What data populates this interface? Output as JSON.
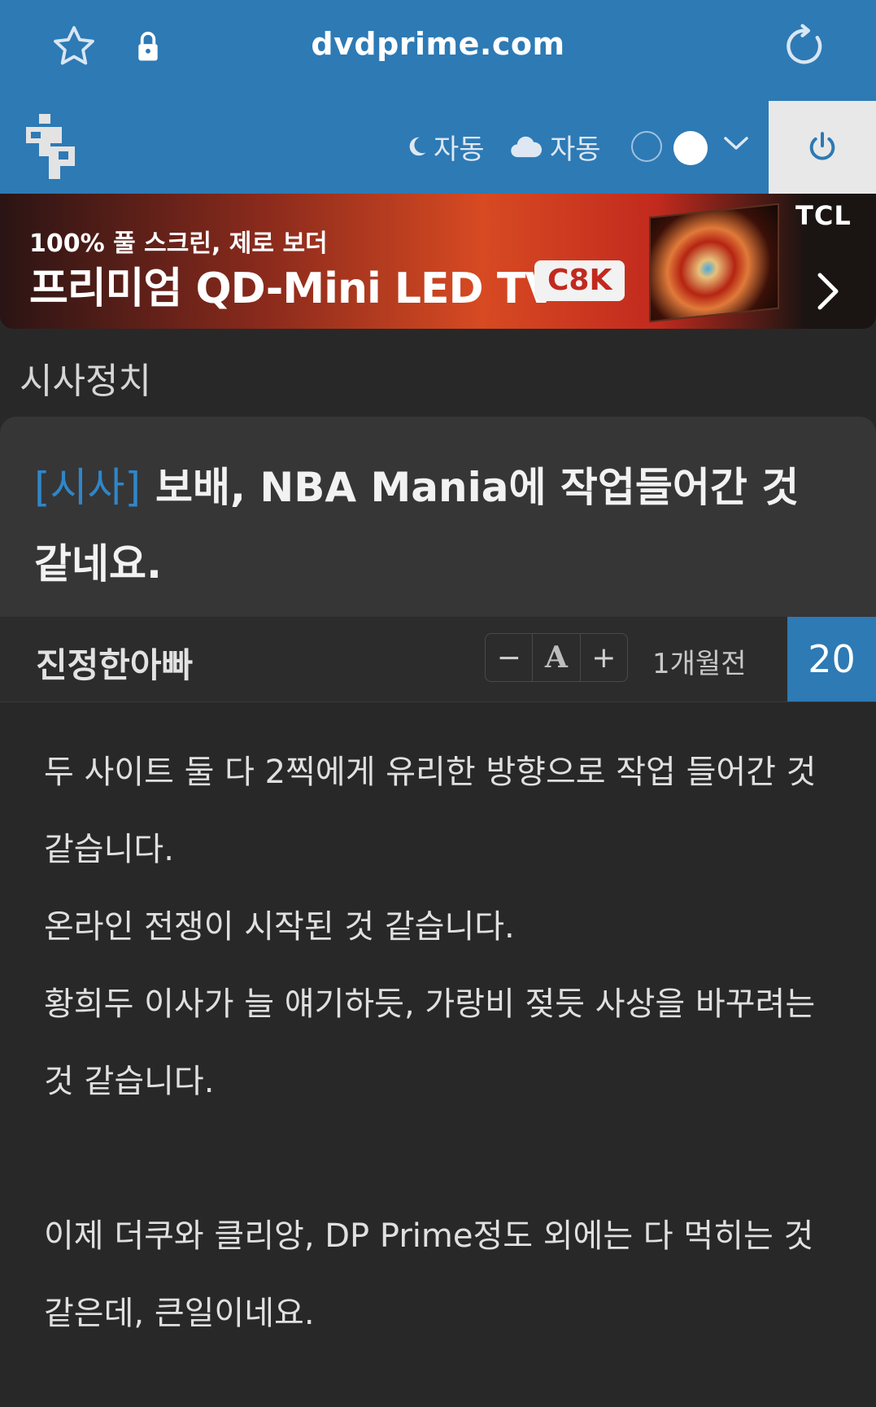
{
  "browser": {
    "url": "dvdprime.com"
  },
  "header": {
    "theme_label": "자동",
    "weather_label": "자동"
  },
  "banner": {
    "line1": "100% 풀 스크린, 제로 보더",
    "line2": "프리미엄 QD-Mini LED TV",
    "badge": "C8K",
    "brand": "TCL"
  },
  "board": {
    "name": "시사정치"
  },
  "post": {
    "category": "[시사]",
    "title": "보배, NBA Mania에 작업들어간 것 같네요.",
    "author": "진정한아빠",
    "font_minus": "−",
    "font_a": "A",
    "font_plus": "+",
    "time": "1개월전",
    "count": "20",
    "paragraphs": [
      "두 사이트 둘 다 2찍에게 유리한 방향으로 작업 들어간 것 같습니다.",
      "온라인 전쟁이 시작된 것 같습니다.",
      "황희두 이사가 늘 얘기하듯, 가랑비 젖듯 사상을 바꾸려는 것 같습니다.",
      "",
      "이제 더쿠와 클리앙, DP Prime정도 외에는 다 먹히는 것 같은데, 큰일이네요."
    ]
  },
  "colors": {
    "header_blue": "#2d7ab5",
    "category_blue": "#2f86c8",
    "background": "#282828"
  },
  "icons": [
    "star-icon",
    "lock-icon",
    "reload-icon",
    "site-logo",
    "moon-icon",
    "cloud-icon",
    "chevron-down-icon",
    "power-icon",
    "chevron-right-icon"
  ]
}
